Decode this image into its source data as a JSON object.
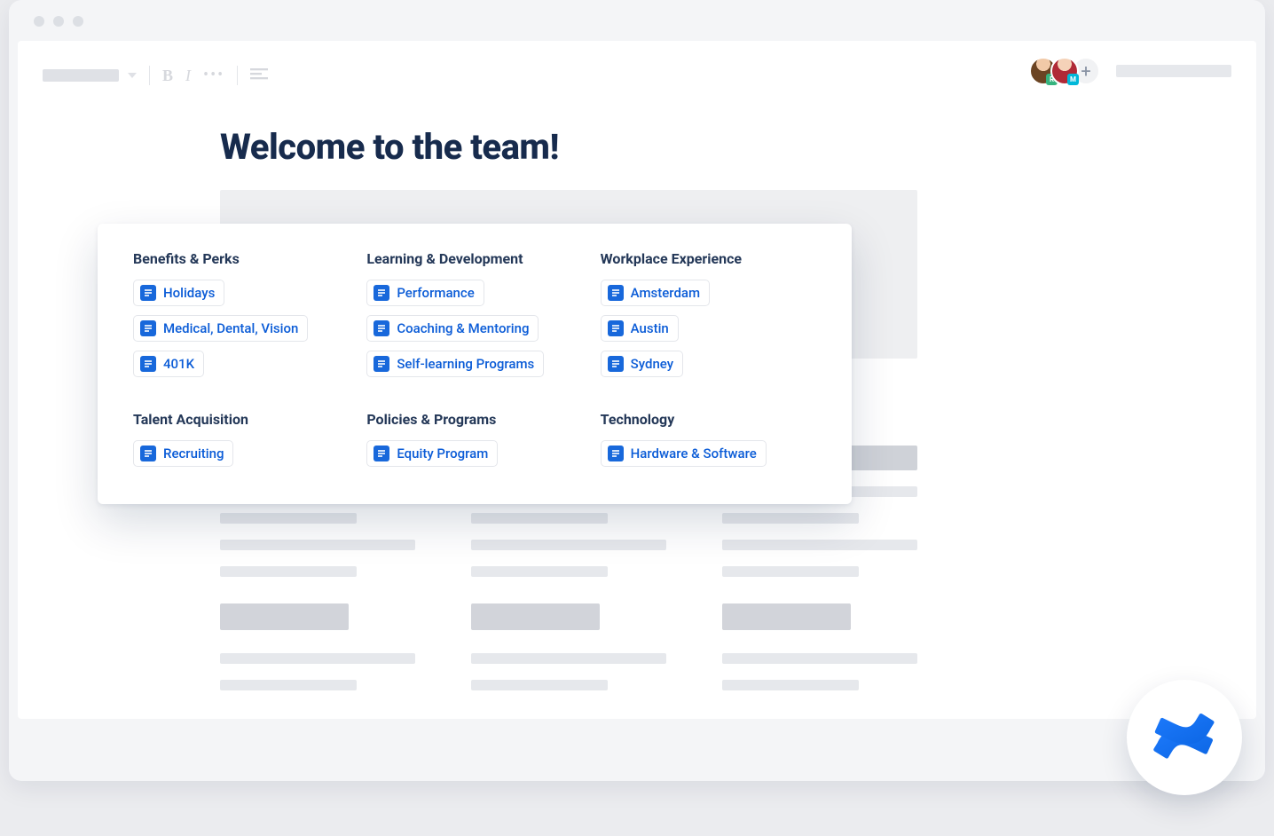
{
  "page": {
    "title": "Welcome to the team!"
  },
  "avatars": {
    "first": "R",
    "second": "M",
    "add": "+"
  },
  "popover": {
    "columns": [
      {
        "heading": "Benefits & Perks",
        "items": [
          "Holidays",
          "Medical, Dental, Vision",
          "401K"
        ]
      },
      {
        "heading": "Learning & Development",
        "items": [
          "Performance",
          "Coaching & Mentoring",
          "Self-learning Programs"
        ]
      },
      {
        "heading": "Workplace Experience",
        "items": [
          "Amsterdam",
          "Austin",
          "Sydney"
        ]
      },
      {
        "heading": "Talent Acquisition",
        "items": [
          "Recruiting"
        ]
      },
      {
        "heading": "Policies & Programs",
        "items": [
          "Equity Program"
        ]
      },
      {
        "heading": "Technology",
        "items": [
          "Hardware & Software"
        ]
      }
    ]
  }
}
